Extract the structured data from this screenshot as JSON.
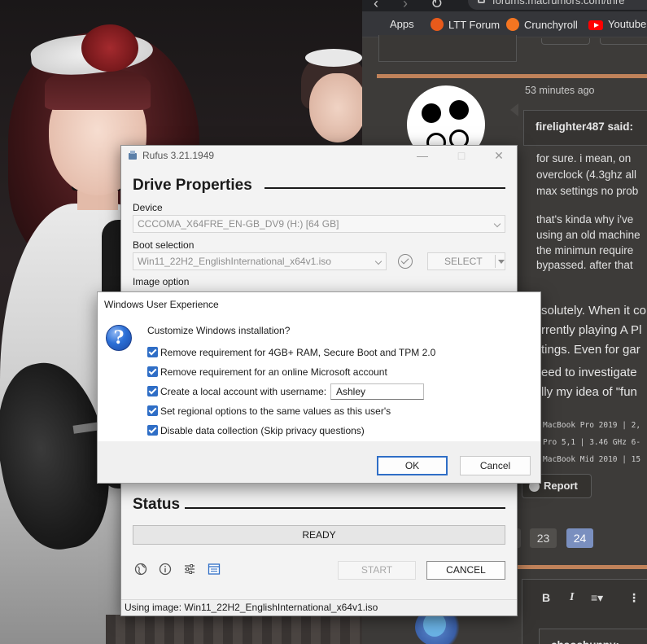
{
  "browser": {
    "url_text": "forums.macrumors.com/thre",
    "bookmarks": [
      "Apps",
      "LTT Forum",
      "Crunchyroll",
      "Youtube"
    ],
    "post": {
      "time_ago": "53 minutes ago",
      "quote_author": "firelighter487 said: ",
      "quote_lines": [
        "for sure. i mean, on",
        "overclock (4.3ghz all",
        "max settings no prob",
        "that's kinda why i've",
        "using an old machine",
        "the minimun require",
        "bypassed. after that"
      ],
      "reply_lines": [
        "solutely. When it co",
        "rrently playing A Pl",
        "tings. Even for gar",
        "eed to investigate",
        "lly my idea of \"fun"
      ],
      "sig_lines": [
        "MacBook Pro 2019 | 2,",
        "Pro 5,1 | 3.46 GHz 6-",
        "MacBook Mid 2010 | 15"
      ],
      "report_label": "Report"
    },
    "pagination": [
      "23",
      "24"
    ],
    "editor": {
      "bold": "B",
      "italic": "I",
      "quote_author": "chaosbunny:"
    }
  },
  "rufus": {
    "title": "Rufus 3.21.1949",
    "drive_properties_heading": "Drive Properties",
    "device_label": "Device",
    "device_value": "CCCOMA_X64FRE_EN-GB_DV9 (H:) [64 GB]",
    "boot_label": "Boot selection",
    "boot_value": "Win11_22H2_EnglishInternational_x64v1.iso",
    "select_label": "SELECT",
    "image_option_label": "Image option",
    "status_heading": "Status",
    "status_text": "READY",
    "start_label": "START",
    "cancel_label": "CANCEL",
    "statusline": "Using image: Win11_22H2_EnglishInternational_x64v1.iso"
  },
  "wue": {
    "title": "Windows User Experience",
    "heading": "Customize Windows installation?",
    "options": [
      "Remove requirement for 4GB+ RAM, Secure Boot and TPM 2.0",
      "Remove requirement for an online Microsoft account",
      "Create a local account with username:",
      "Set regional options to the same values as this user's",
      "Disable data collection (Skip privacy questions)"
    ],
    "username": "Ashley",
    "ok_label": "OK",
    "cancel_label": "Cancel"
  },
  "colors": {
    "accent_blue": "#2f6ec6",
    "forum_divider": "#c0825a",
    "page_active": "#7a8fbf"
  }
}
